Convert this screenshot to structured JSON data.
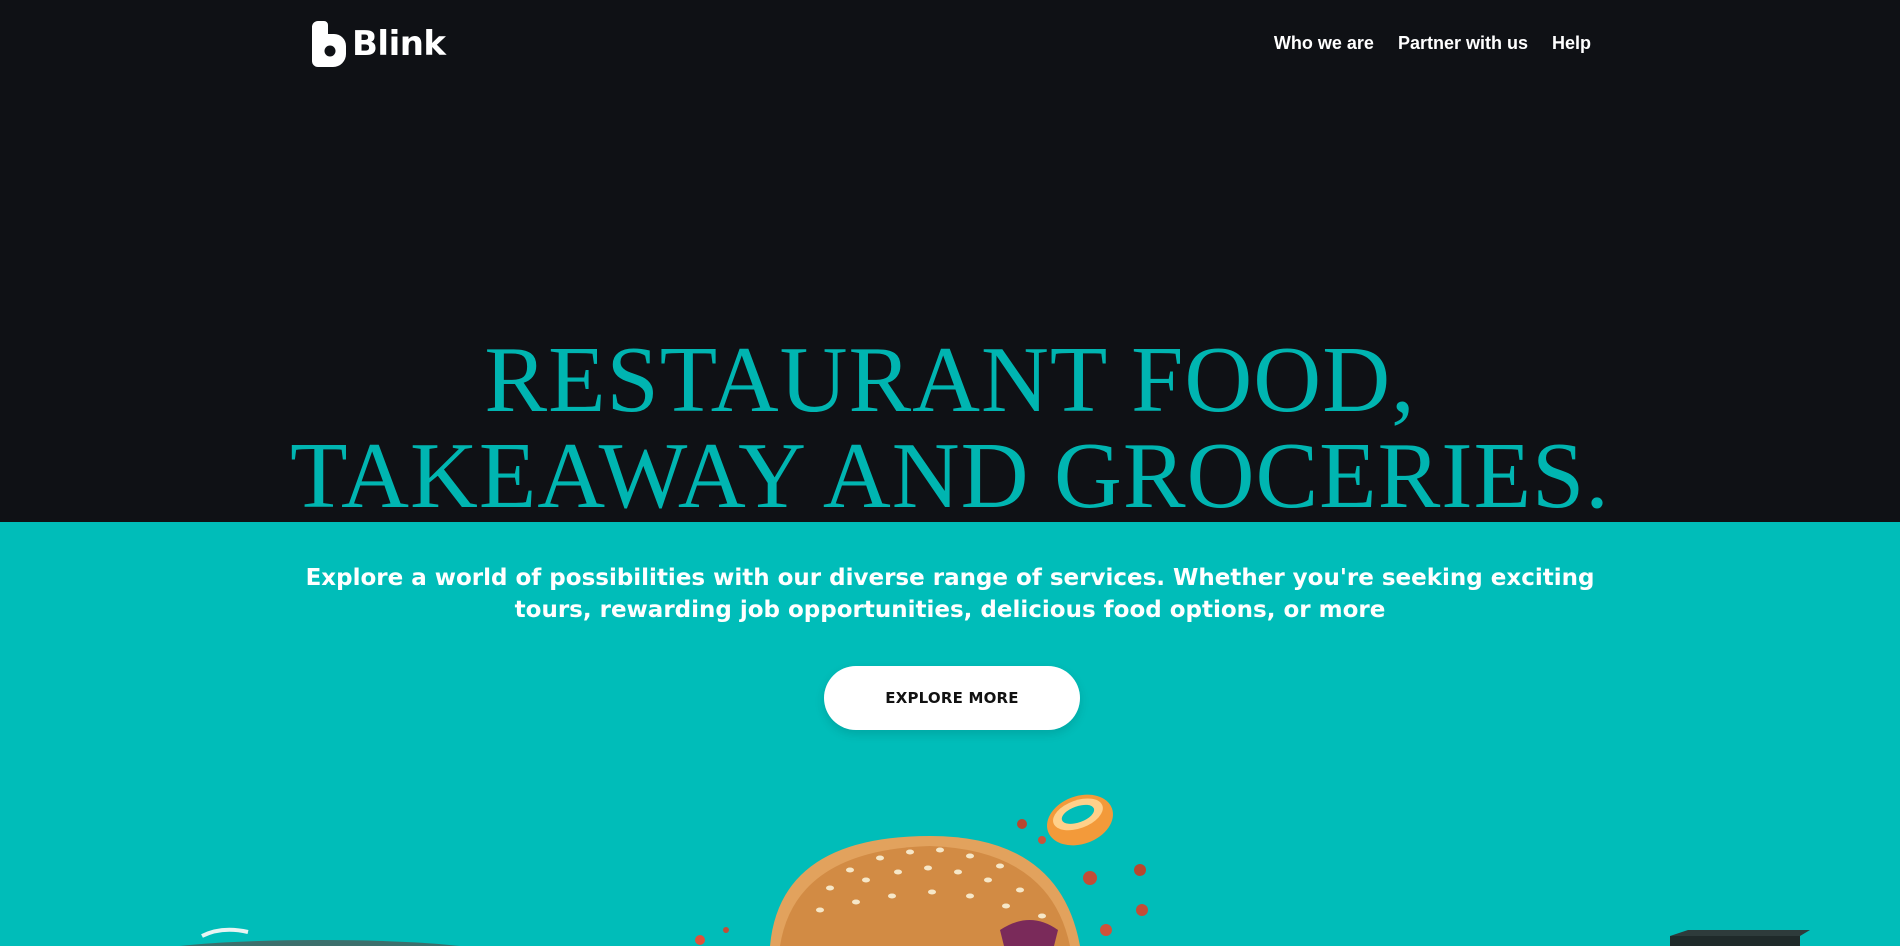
{
  "brand": {
    "name": "Blink",
    "logo_icon": "blink-logo-icon"
  },
  "nav": {
    "items": [
      {
        "label": "Who we are"
      },
      {
        "label": "Partner with us"
      },
      {
        "label": "Help"
      }
    ]
  },
  "hero": {
    "headline_line1": "RESTAURANT FOOD,",
    "headline_line2": "TAKEAWAY AND GROCERIES.",
    "subtext": "Explore a world of possibilities with our diverse range of services. Whether you're seeking exciting tours, rewarding job opportunities, delicious food options, or more",
    "cta_label": "EXPLORE MORE"
  },
  "colors": {
    "dark_bg": "#0f1115",
    "teal": "#00bdb9",
    "headline": "#00b5b1",
    "white": "#ffffff"
  }
}
